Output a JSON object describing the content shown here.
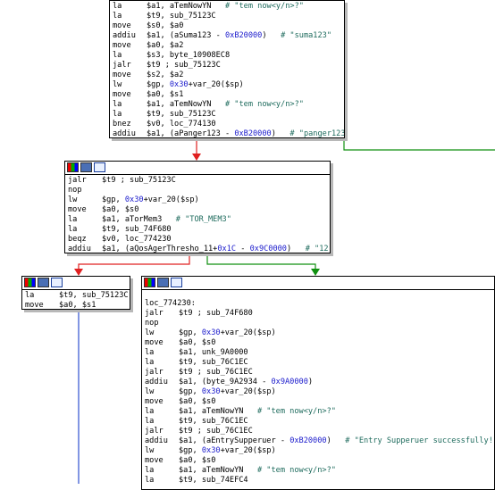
{
  "block1": [
    {
      "mn": "la",
      "ops": "$a1, aTemNowYN",
      "cmt": "# \"tem now<y/n>?\""
    },
    {
      "mn": "la",
      "ops": "$t9, sub_75123C",
      "cmt": ""
    },
    {
      "mn": "move",
      "ops": "$s0, $a0",
      "cmt": ""
    },
    {
      "mn": "addiu",
      "ops": "$a1, (aSuma123 - 0xB20000)",
      "cmt": "# \"suma123\""
    },
    {
      "mn": "move",
      "ops": "$a0, $a2",
      "cmt": ""
    },
    {
      "mn": "la",
      "ops": "$s3, byte_10908EC8",
      "cmt": ""
    },
    {
      "mn": "jalr",
      "ops": "$t9 ; sub_75123C",
      "cmt": ""
    },
    {
      "mn": "move",
      "ops": "$s2, $a2",
      "cmt": ""
    },
    {
      "mn": "lw",
      "ops": "$gp, 0x30+var_20($sp)",
      "cmt": ""
    },
    {
      "mn": "move",
      "ops": "$a0, $s1",
      "cmt": ""
    },
    {
      "mn": "la",
      "ops": "$a1, aTemNowYN",
      "cmt": "# \"tem now<y/n>?\""
    },
    {
      "mn": "la",
      "ops": "$t9, sub_75123C",
      "cmt": ""
    },
    {
      "mn": "bnez",
      "ops": "$v0, loc_774130",
      "cmt": ""
    },
    {
      "mn": "addiu",
      "ops": "$a1, (aPanger123 - 0xB20000)",
      "cmt": "# \"panger123\""
    }
  ],
  "block2": [
    {
      "mn": "jalr",
      "ops": "$t9 ; sub_75123C",
      "cmt": ""
    },
    {
      "mn": "nop",
      "ops": "",
      "cmt": ""
    },
    {
      "mn": "lw",
      "ops": "$gp, 0x30+var_20($sp)",
      "cmt": ""
    },
    {
      "mn": "move",
      "ops": "$a0, $s0",
      "cmt": ""
    },
    {
      "mn": "la",
      "ops": "$a1, aTorMem3",
      "cmt": "# \"TOR_MEM3\""
    },
    {
      "mn": "la",
      "ops": "$t9, sub_74F680",
      "cmt": ""
    },
    {
      "mn": "beqz",
      "ops": "$v0, loc_774230",
      "cmt": ""
    },
    {
      "mn": "addiu",
      "ops": "$a1, (aQosAgerThresho_11+0x1C - 0x9C0000)",
      "cmt": "# \"12\""
    }
  ],
  "block3": [
    {
      "mn": "la",
      "ops": "$t9, sub_75123C",
      "cmt": ""
    },
    {
      "mn": "move",
      "ops": "$a0, $s1",
      "cmt": ""
    }
  ],
  "block4_label": "loc_774230:",
  "block4": [
    {
      "mn": "jalr",
      "ops": "$t9 ; sub_74F680",
      "cmt": ""
    },
    {
      "mn": "nop",
      "ops": "",
      "cmt": ""
    },
    {
      "mn": "lw",
      "ops": "$gp, 0x30+var_20($sp)",
      "cmt": ""
    },
    {
      "mn": "move",
      "ops": "$a0, $s0",
      "cmt": ""
    },
    {
      "mn": "la",
      "ops": "$a1, unk_9A0000",
      "cmt": ""
    },
    {
      "mn": "la",
      "ops": "$t9, sub_76C1EC",
      "cmt": ""
    },
    {
      "mn": "jalr",
      "ops": "$t9 ; sub_76C1EC",
      "cmt": ""
    },
    {
      "mn": "addiu",
      "ops": "$a1, (byte_9A2934 - 0x9A0000)",
      "cmt": ""
    },
    {
      "mn": "lw",
      "ops": "$gp, 0x30+var_20($sp)",
      "cmt": ""
    },
    {
      "mn": "move",
      "ops": "$a0, $s0",
      "cmt": ""
    },
    {
      "mn": "la",
      "ops": "$a1, aTemNowYN",
      "cmt": "# \"tem now<y/n>?\""
    },
    {
      "mn": "la",
      "ops": "$t9, sub_76C1EC",
      "cmt": ""
    },
    {
      "mn": "jalr",
      "ops": "$t9 ; sub_76C1EC",
      "cmt": ""
    },
    {
      "mn": "addiu",
      "ops": "$a1, (aEntrySupperuer - 0xB20000)",
      "cmt": "# \"Entry Supperuer successfully!\""
    },
    {
      "mn": "lw",
      "ops": "$gp, 0x30+var_20($sp)",
      "cmt": ""
    },
    {
      "mn": "move",
      "ops": "$a0, $s0",
      "cmt": ""
    },
    {
      "mn": "la",
      "ops": "$a1, aTemNowYN",
      "cmt": "# \"tem now<y/n>?\""
    },
    {
      "mn": "la",
      "ops": "$t9, sub_74EFC4",
      "cmt": ""
    }
  ],
  "colors": {
    "false_edge": "#e02020",
    "true_edge": "#109010",
    "flow_edge": "#3050d0",
    "comment": "#1e6b5d"
  }
}
